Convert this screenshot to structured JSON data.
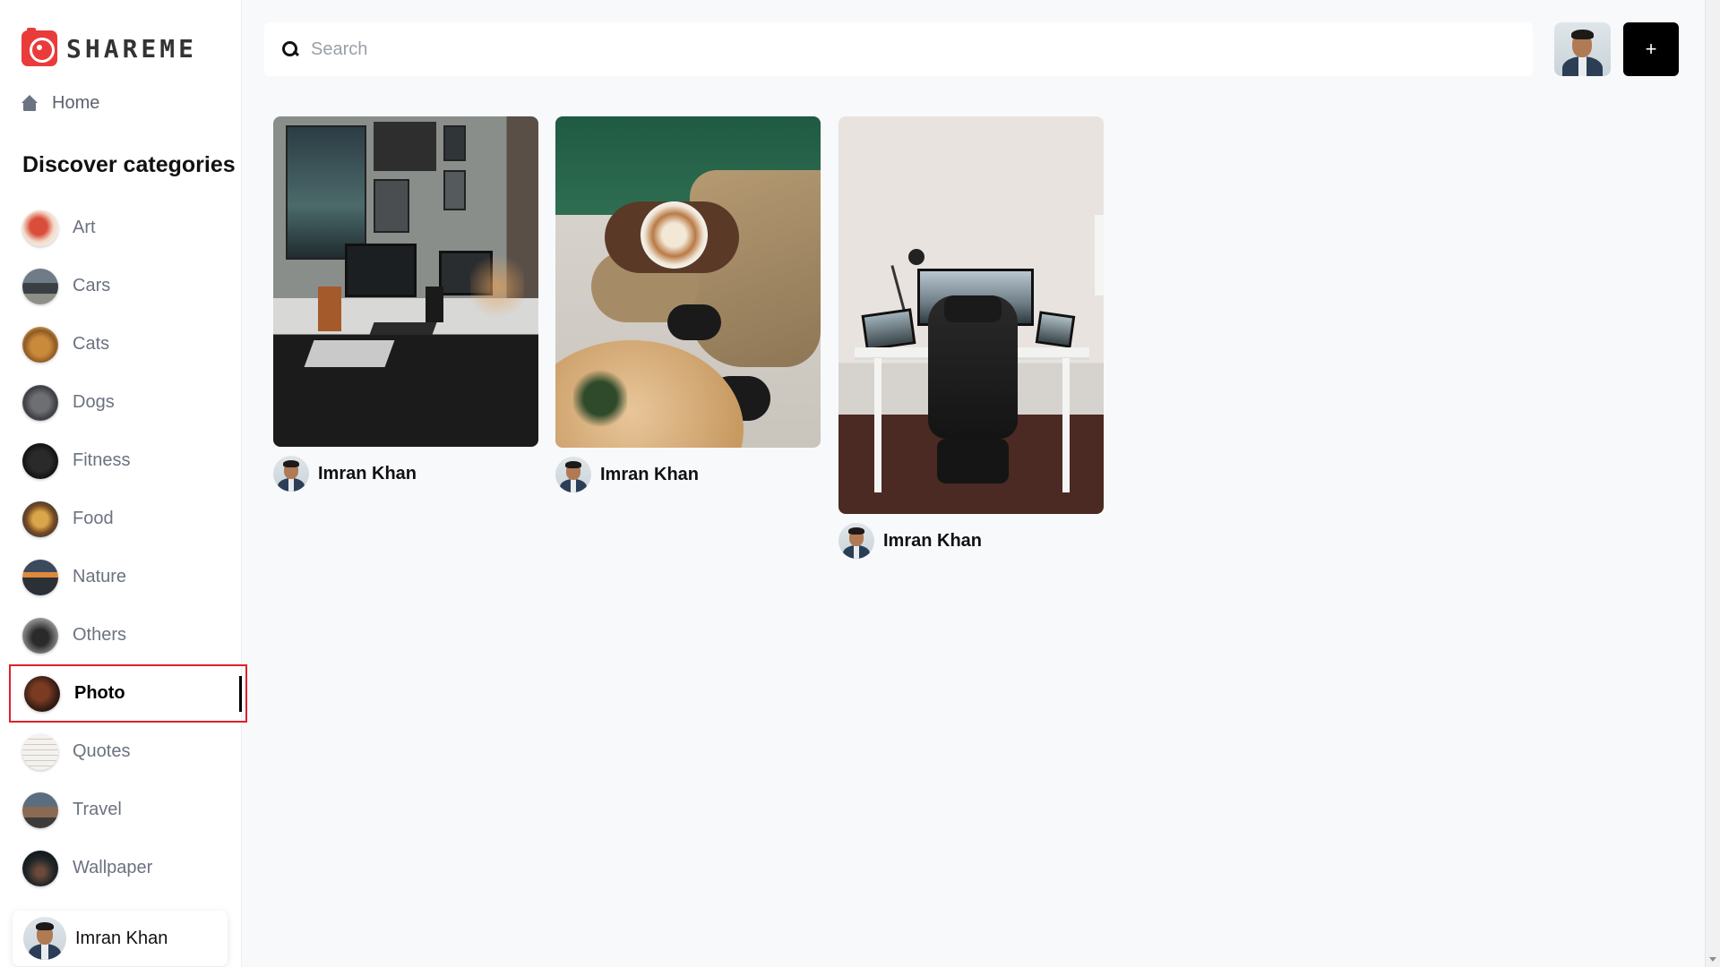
{
  "app": {
    "logo_text": "SHAREME",
    "brand_color": "#ea3b3b"
  },
  "sidebar": {
    "home_label": "Home",
    "discover_title": "Discover categories",
    "categories": [
      {
        "label": "Art",
        "active": false
      },
      {
        "label": "Cars",
        "active": false
      },
      {
        "label": "Cats",
        "active": false
      },
      {
        "label": "Dogs",
        "active": false
      },
      {
        "label": "Fitness",
        "active": false
      },
      {
        "label": "Food",
        "active": false
      },
      {
        "label": "Nature",
        "active": false
      },
      {
        "label": "Others",
        "active": false
      },
      {
        "label": "Photo",
        "active": true
      },
      {
        "label": "Quotes",
        "active": false
      },
      {
        "label": "Travel",
        "active": false
      },
      {
        "label": "Wallpaper",
        "active": false
      }
    ],
    "user_name": "Imran Khan"
  },
  "header": {
    "search_placeholder": "Search",
    "search_value": "",
    "add_label": "+"
  },
  "pins": [
    {
      "author": "Imran Khan",
      "image": "desk-setup-photo"
    },
    {
      "author": "Imran Khan",
      "image": "latte-art-photo"
    },
    {
      "author": "Imran Khan",
      "image": "office-chair-desk-photo"
    }
  ],
  "colors": {
    "active_outline": "#e0202a",
    "add_button": "#000000",
    "background": "#f8f9fb"
  }
}
